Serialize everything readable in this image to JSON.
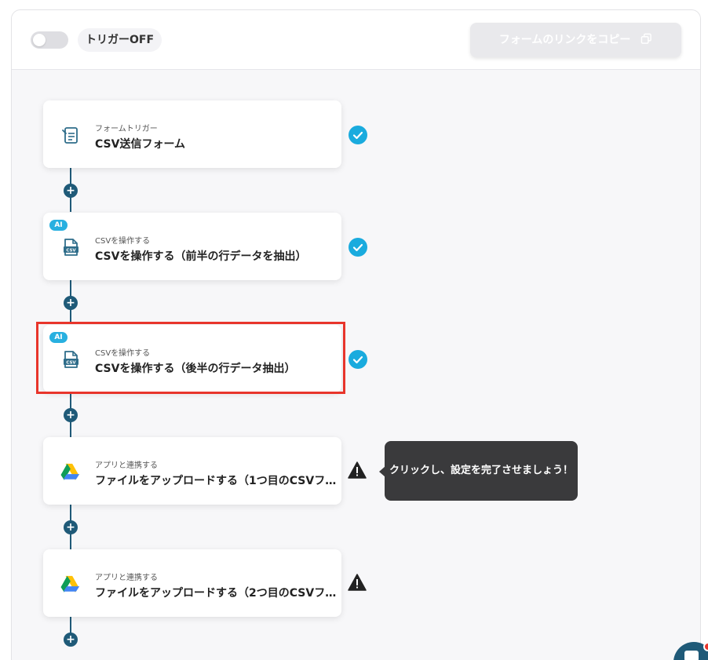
{
  "header": {
    "trigger_label": "トリガーOFF",
    "copy_button_label": "フォームのリンクをコピー"
  },
  "steps": [
    {
      "subtitle": "フォームトリガー",
      "title": "CSV送信フォーム",
      "icon": "form-icon",
      "status": "complete"
    },
    {
      "badge": "AI",
      "subtitle": "CSVを操作する",
      "title": "CSVを操作する（前半の行データを抽出）",
      "icon": "csv-file-icon",
      "status": "complete"
    },
    {
      "badge": "AI",
      "subtitle": "CSVを操作する",
      "title": "CSVを操作する（後半の行データ抽出）",
      "icon": "csv-file-icon",
      "status": "complete"
    },
    {
      "subtitle": "アプリと連携する",
      "title": "ファイルをアップロードする（1つ目のCSVフ…",
      "icon": "google-drive-icon",
      "status": "warning"
    },
    {
      "subtitle": "アプリと連携する",
      "title": "ファイルをアップロードする（2つ目のCSVフ…",
      "icon": "google-drive-icon",
      "status": "warning"
    }
  ],
  "tooltip": {
    "text": "クリックし、設定を完了させましょう！"
  },
  "colors": {
    "accent": "#1aabde",
    "connector": "#1f5a78",
    "highlight": "#e8352b",
    "warning": "#222222"
  }
}
